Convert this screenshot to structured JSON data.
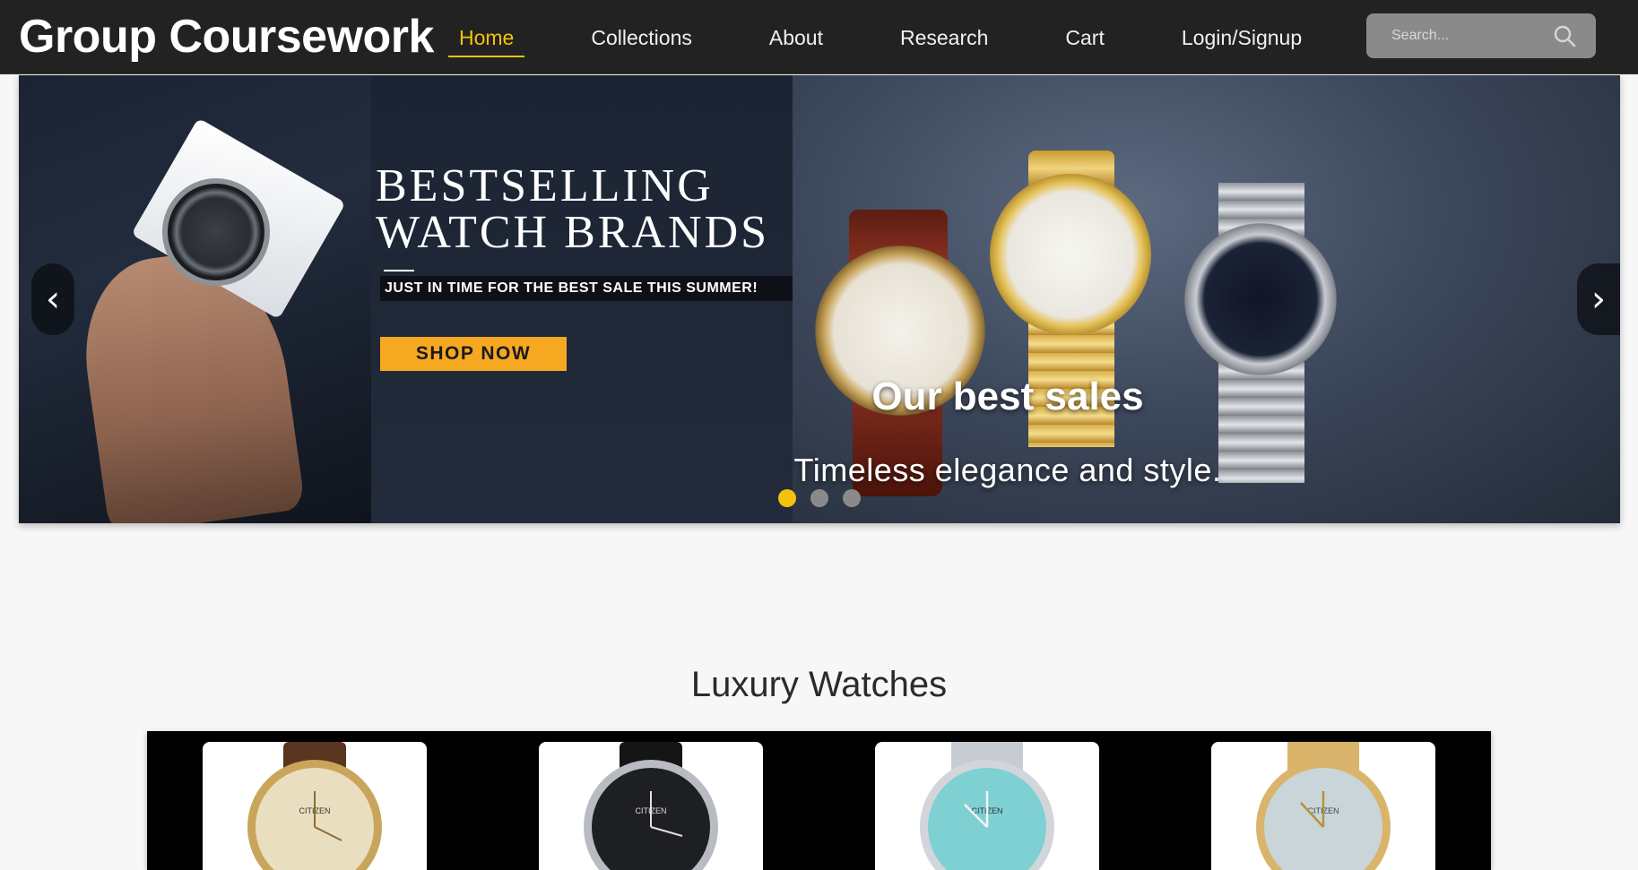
{
  "header": {
    "brand": "Group Coursework",
    "nav": [
      {
        "label": "Home",
        "active": true
      },
      {
        "label": "Collections",
        "active": false
      },
      {
        "label": "About",
        "active": false
      },
      {
        "label": "Research",
        "active": false
      },
      {
        "label": "Cart",
        "active": false
      },
      {
        "label": "Login/Signup",
        "active": false
      }
    ],
    "search_placeholder": "Search...",
    "search_icon": "search-icon"
  },
  "carousel": {
    "promo": {
      "title_line1": "BESTSELLING",
      "title_line2": "WATCH BRANDS",
      "subtitle": "JUST IN TIME FOR THE BEST SALE THIS SUMMER!",
      "cta": "SHOP NOW"
    },
    "caption_title": "Our best sales",
    "caption_text": "Timeless elegance and style.",
    "prev_label": "‹",
    "next_label": "›",
    "slide_count": 3,
    "active_slide": 1
  },
  "section": {
    "title": "Luxury Watches",
    "products": [
      {
        "name": "citizen-gold-leather-watch",
        "dial": "#e9dfc0",
        "strap": "#5a3520",
        "brand": "CITIZEN"
      },
      {
        "name": "citizen-black-dial-watch",
        "dial": "#1e1f22",
        "strap": "#151515",
        "brand": "CITIZEN"
      },
      {
        "name": "citizen-turquoise-dial-watch",
        "dial": "#7fd0d3",
        "strap": "#c7ccd2",
        "brand": "CITIZEN"
      },
      {
        "name": "citizen-gold-bracelet-watch",
        "dial": "#c9d5d8",
        "strap": "#d9b46a",
        "brand": "CITIZEN"
      }
    ]
  },
  "colors": {
    "accent": "#f4c20d",
    "navbar": "#222222",
    "page_bg": "#f7f7f7",
    "cta": "#f6a821"
  }
}
